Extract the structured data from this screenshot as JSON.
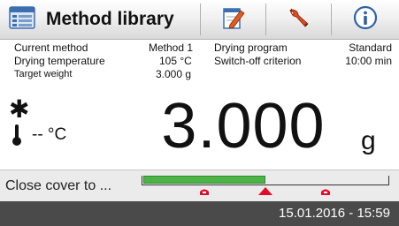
{
  "header": {
    "title": "Method library",
    "icons": [
      "library-icon",
      "edit-icon",
      "wrench-icon",
      "info-icon"
    ]
  },
  "info": {
    "current_method_label": "Current method",
    "current_method_value": "Method 1",
    "drying_program_label": "Drying program",
    "drying_program_value": "Standard",
    "drying_temperature_label": "Drying temperature",
    "drying_temperature_value": "105 °C",
    "switch_off_label": "Switch-off criterion",
    "switch_off_value": "10:00 min",
    "target_weight_label": "Target weight",
    "target_weight_value": "3.000 g"
  },
  "weighing": {
    "stability_symbol": "✱",
    "temperature": "-- °C",
    "value": "3.000",
    "unit": "g"
  },
  "status": {
    "message": "Close cover to ...",
    "progress_fraction": 0.5,
    "colors": {
      "fill": "#4cb447",
      "marker": "#e30b2a"
    }
  },
  "footer": {
    "datetime": "15.01.2016 - 15:59"
  }
}
